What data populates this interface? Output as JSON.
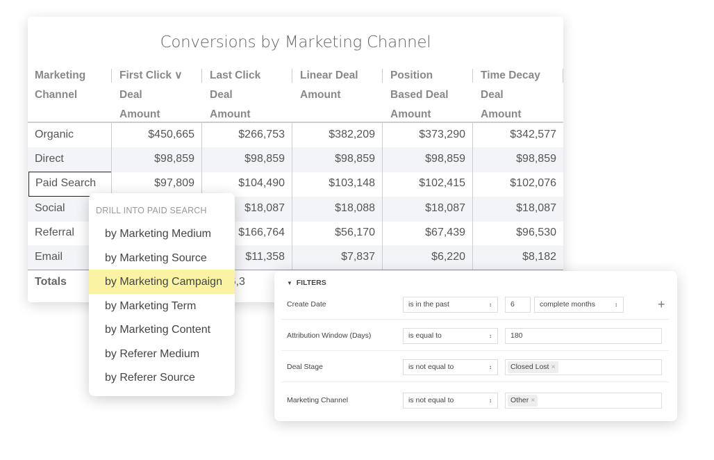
{
  "table": {
    "title": "Conversions by Marketing Channel",
    "headers": [
      {
        "lines": [
          "Marketing",
          "Channel"
        ]
      },
      {
        "lines": [
          "First Click ∨",
          "Deal",
          "Amount"
        ],
        "sorted": true
      },
      {
        "lines": [
          "Last Click",
          "Deal",
          "Amount"
        ]
      },
      {
        "lines": [
          "Linear Deal",
          "Amount"
        ]
      },
      {
        "lines": [
          "Position",
          "Based Deal",
          "Amount"
        ]
      },
      {
        "lines": [
          "Time Decay",
          "Deal",
          "Amount"
        ]
      }
    ],
    "rows": [
      [
        "Organic",
        "$450,665",
        "$266,753",
        "$382,209",
        "$373,290",
        "$342,577"
      ],
      [
        "Direct",
        "$98,859",
        "$98,859",
        "$98,859",
        "$98,859",
        "$98,859"
      ],
      [
        "Paid Search",
        "$97,809",
        "$104,490",
        "$103,148",
        "$102,415",
        "$102,076"
      ],
      [
        "Social",
        "",
        "$18,087",
        "$18,088",
        "$18,087",
        "$18,087"
      ],
      [
        "Referral",
        "",
        "$166,764",
        "$56,170",
        "$67,439",
        "$96,530"
      ],
      [
        "Email",
        "",
        "$11,358",
        "$7,837",
        "$6,220",
        "$8,182"
      ]
    ],
    "totals": [
      "Totals",
      "",
      "$666,3",
      "",
      "",
      ""
    ],
    "selected_row": "Paid Search"
  },
  "drill": {
    "header": "DRILL INTO PAID SEARCH",
    "items": [
      "by Marketing Medium",
      "by Marketing Source",
      "by Marketing Campaign",
      "by Marketing Term",
      "by Marketing Content",
      "by Referer Medium",
      "by Referer Source"
    ],
    "highlighted": "by Marketing Campaign",
    "highlight_color": "#faf3a3"
  },
  "filters": {
    "header": "FILTERS",
    "rows": [
      {
        "label": "Create Date",
        "operator": "is in the past",
        "value": "6",
        "unit": "complete months"
      },
      {
        "label": "Attribution Window (Days)",
        "operator": "is equal to",
        "value": "180"
      },
      {
        "label": "Deal Stage",
        "operator": "is not equal to",
        "chip": "Closed Lost"
      },
      {
        "label": "Marketing Channel",
        "operator": "is not equal to",
        "chip": "Other"
      }
    ],
    "add_icon": "plus-icon"
  }
}
